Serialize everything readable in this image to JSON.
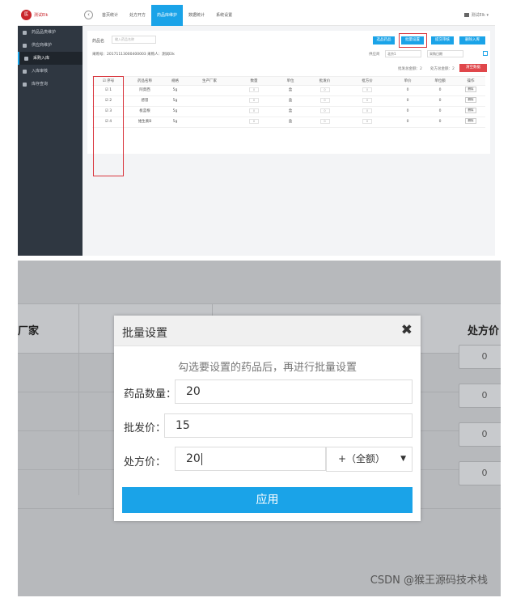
{
  "top": {
    "brand": "测试Elk",
    "nav": [
      "首页统计",
      "处方开方",
      "药品库维护",
      "数据统计",
      "系统设置"
    ],
    "nav_active_index": 2,
    "user": "测试Elk",
    "sidebar": [
      "药品品类维护",
      "供应商维护",
      "采购入库",
      "入库审核",
      "库存查询"
    ],
    "sidebar_active_index": 2,
    "filter": {
      "label": "药品名",
      "placeholder": "输入药品名称"
    },
    "buttons": [
      "选品药品",
      "批量设置",
      "提交审核",
      "删除入库"
    ],
    "order_info": "采购号：20171113000400003   采购人：测试Elk",
    "supplier_label": "供应商",
    "supplier_value": "北京1",
    "date_value": "采购日期",
    "sums": [
      "批发总金额：2",
      "处方总金额：2"
    ],
    "clear_button": "清空数据",
    "table": {
      "headers": [
        "序号",
        "药品名称",
        "规格",
        "生产厂家",
        "数量",
        "单位",
        "批发价",
        "批方价",
        "单价",
        "单位额",
        "操作"
      ],
      "rows": [
        {
          "no": "1",
          "name": "阿莫西",
          "spec": "5g",
          "qty": "0",
          "unit": "盒",
          "wholesale": "0",
          "rx": "0",
          "price": "0",
          "amt": "0",
          "op": "删除"
        },
        {
          "no": "2",
          "name": "感冒",
          "spec": "5g",
          "qty": "0",
          "unit": "盒",
          "wholesale": "0",
          "rx": "0",
          "price": "0",
          "amt": "0",
          "op": "删除"
        },
        {
          "no": "3",
          "name": "板蓝根",
          "spec": "5g",
          "qty": "0",
          "unit": "盒",
          "wholesale": "0",
          "rx": "0",
          "price": "0",
          "amt": "0",
          "op": "删除"
        },
        {
          "no": "4",
          "name": "维生素B",
          "spec": "5g",
          "qty": "0",
          "unit": "盒",
          "wholesale": "0",
          "rx": "0",
          "price": "0",
          "amt": "0",
          "op": "删除"
        }
      ]
    }
  },
  "bottom": {
    "bg_headers": [
      "厂家",
      "处方价"
    ],
    "bg_values": [
      "0",
      "0",
      "0",
      "0"
    ],
    "modal": {
      "title": "批量设置",
      "close": "✖",
      "hint": "勾选要设置的药品后，再进行批量设置",
      "qty_label": "药品数量：",
      "qty_value": "20",
      "wholesale_label": "批发价：",
      "wholesale_value": "15",
      "rx_label": "处方价：",
      "rx_value": "20",
      "rx_mode": "+（全额）",
      "apply": "应用"
    },
    "watermark": "CSDN @猴王源码技术栈"
  },
  "colors": {
    "accent": "#1aa3e8",
    "danger": "#e0474b",
    "sidebar": "#2f3741",
    "highlight": "#d9363e"
  }
}
